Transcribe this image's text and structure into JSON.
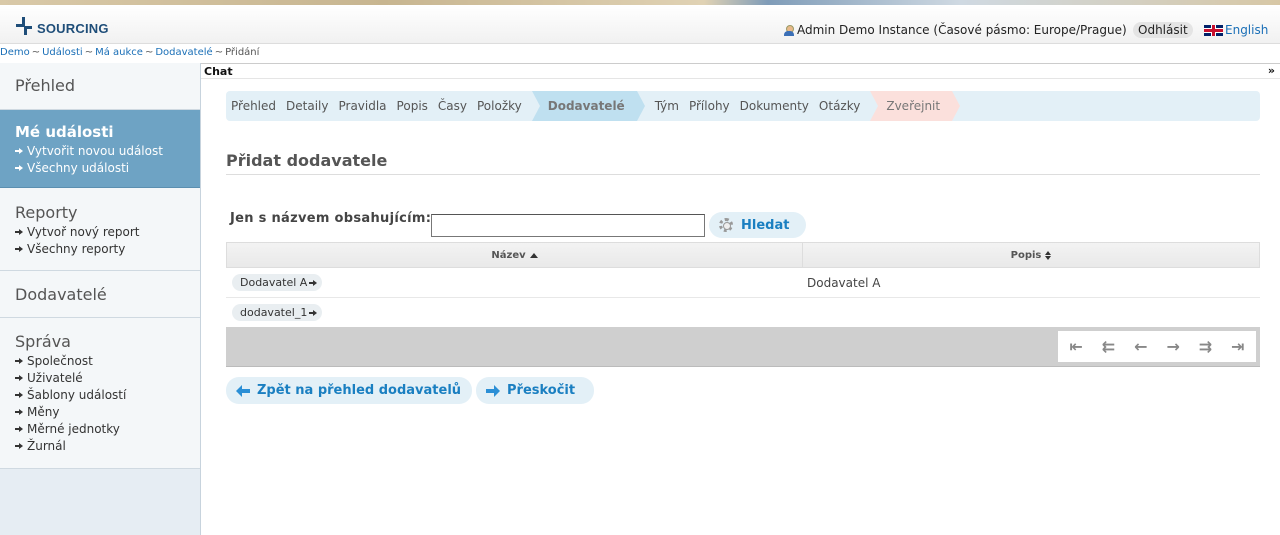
{
  "header": {
    "logo_text": "SOURCING",
    "user": "Admin Demo Instance (Časové pásmo: Europe/Prague)",
    "logout": "Odhlásit",
    "language": "English"
  },
  "breadcrumb": {
    "items": [
      "Demo",
      "Události",
      "Má aukce",
      "Dodavatelé"
    ],
    "current": "Přidání",
    "separator": "~"
  },
  "chat": {
    "label": "Chat",
    "toggle": "»"
  },
  "sidebar": {
    "overview": "Přehled",
    "my_events": {
      "title": "Mé události",
      "items": [
        "Vytvořit novou událost",
        "Všechny události"
      ]
    },
    "reports": {
      "title": "Reporty",
      "items": [
        "Vytvoř nový report",
        "Všechny reporty"
      ]
    },
    "suppliers": "Dodavatelé",
    "admin": {
      "title": "Správa",
      "items": [
        "Společnost",
        "Uživatelé",
        "Šablony událostí",
        "Měny",
        "Měrné jednotky",
        "Žurnál"
      ]
    }
  },
  "steps": {
    "items": [
      "Přehled",
      "Detaily",
      "Pravidla",
      "Popis",
      "Časy",
      "Položky"
    ],
    "current": "Dodavatelé",
    "after": [
      "Tým",
      "Přílohy",
      "Dokumenty",
      "Otázky"
    ],
    "publish": "Zveřejnit"
  },
  "page": {
    "title": "Přidat dodavatele",
    "filter_label": "Jen s názvem obsahujícím:",
    "filter_value": "",
    "search_button": "Hledat"
  },
  "table": {
    "columns": [
      "Název",
      "Popis"
    ],
    "rows": [
      {
        "name": "Dodavatel A",
        "description": "Dodavatel A"
      },
      {
        "name": "dodavatel_1",
        "description": ""
      }
    ]
  },
  "pager": {
    "first": "⇤",
    "prev_page": "⇇",
    "prev": "←",
    "next": "→",
    "next_page": "⇉",
    "last": "⇥"
  },
  "buttons": {
    "back": "Zpět na přehled dodavatelů",
    "skip": "Přeskočit"
  },
  "colors": {
    "accent": "#1a7fc1",
    "sidebar_active": "#6ea3c4",
    "step_current": "#bfe0f0",
    "step_publish": "#fbe0dc"
  }
}
